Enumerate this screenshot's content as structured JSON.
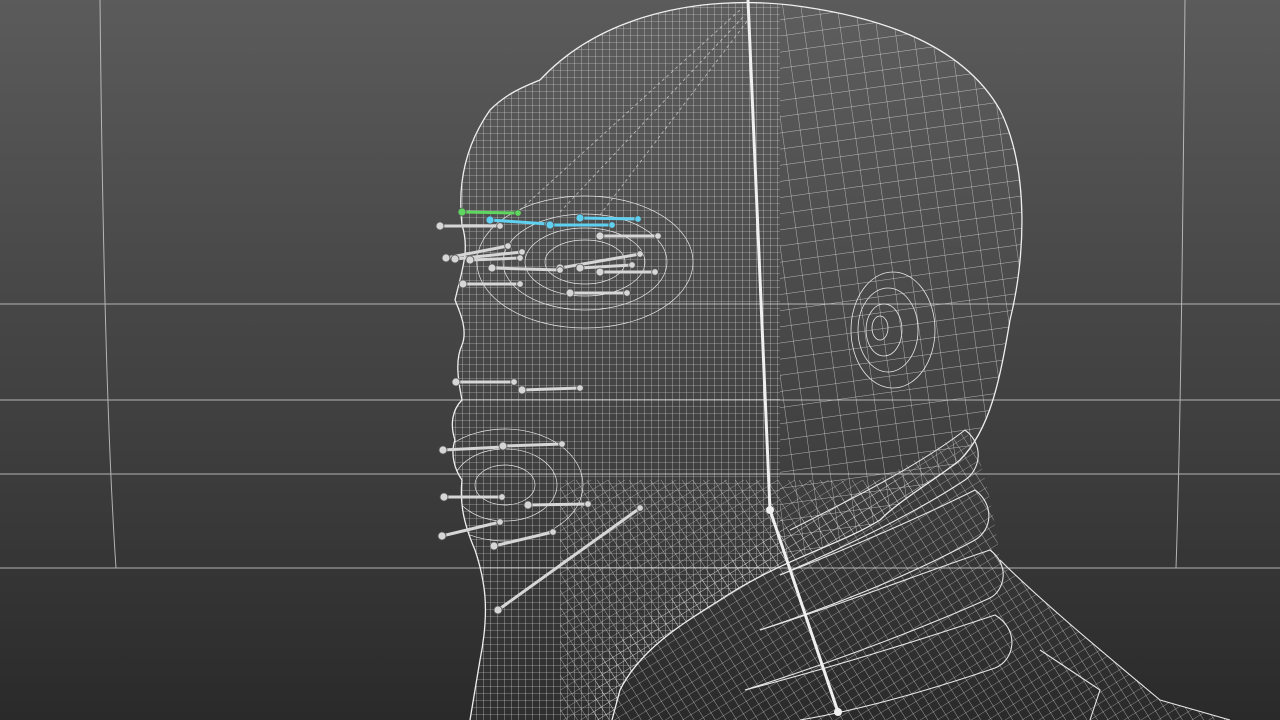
{
  "viewport": {
    "background_top": "#5b5b5b",
    "background_bottom": "#2a2a2a",
    "grid_color": "#c8c8c8",
    "wire_color": "#e2e2e2"
  },
  "controls": {
    "default_color": "#d6d6d6",
    "selected_primary_color": "#5fd65f",
    "selected_secondary_color": "#5fd0f0",
    "joint_color": "#e8e8e8"
  }
}
